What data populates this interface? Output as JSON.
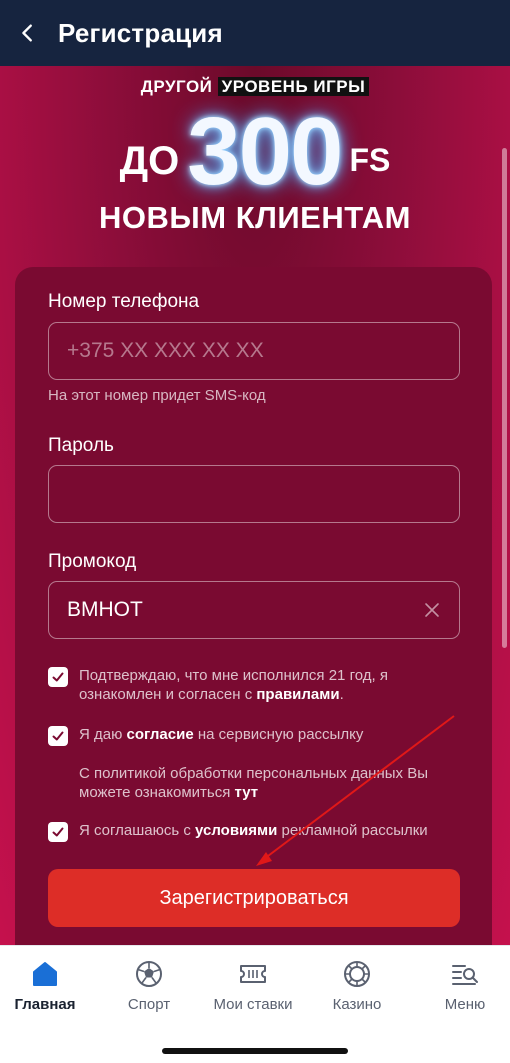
{
  "header": {
    "title": "Регистрация"
  },
  "banner": {
    "tagline_a": "ДРУГОЙ",
    "tagline_b": "УРОВЕНЬ ИГРЫ",
    "prefix": "ДО",
    "amount": "300",
    "suffix": "FS",
    "subline": "НОВЫМ КЛИЕНТАМ"
  },
  "form": {
    "phone_label": "Номер телефона",
    "phone_placeholder": "+375 XX XXX XX XX",
    "phone_hint": "На этот номер придет SMS-код",
    "password_label": "Пароль",
    "password_value": "",
    "promo_label": "Промокод",
    "promo_value": "BMHOT",
    "consent_age_a": "Подтверждаю, что мне исполнился 21 год, я ознакомлен и согласен с ",
    "consent_age_link": "правилами",
    "consent_age_end": ".",
    "consent_mail_a": "Я даю ",
    "consent_mail_link": "согласие",
    "consent_mail_b": " на сервисную рассылку",
    "policy_a": "С политикой обработки персональных данных Вы можете ознакомиться ",
    "policy_link": "тут",
    "consent_ads_a": "Я соглашаюсь с ",
    "consent_ads_link": "условиями",
    "consent_ads_b": " рекламной рассылки",
    "submit_label": "Зарегистрироваться"
  },
  "tabbar": {
    "items": [
      {
        "label": "Главная",
        "icon": "home-icon",
        "active": true
      },
      {
        "label": "Спорт",
        "icon": "soccer-ball-icon",
        "active": false
      },
      {
        "label": "Мои ставки",
        "icon": "ticket-icon",
        "active": false
      },
      {
        "label": "Казино",
        "icon": "casino-chip-icon",
        "active": false
      },
      {
        "label": "Меню",
        "icon": "menu-search-icon",
        "active": false
      }
    ]
  },
  "colors": {
    "header_bg": "#16243f",
    "accent_red": "#dd2d27",
    "card_bg": "#7a0a31",
    "active_tab": "#1a6fd6"
  }
}
